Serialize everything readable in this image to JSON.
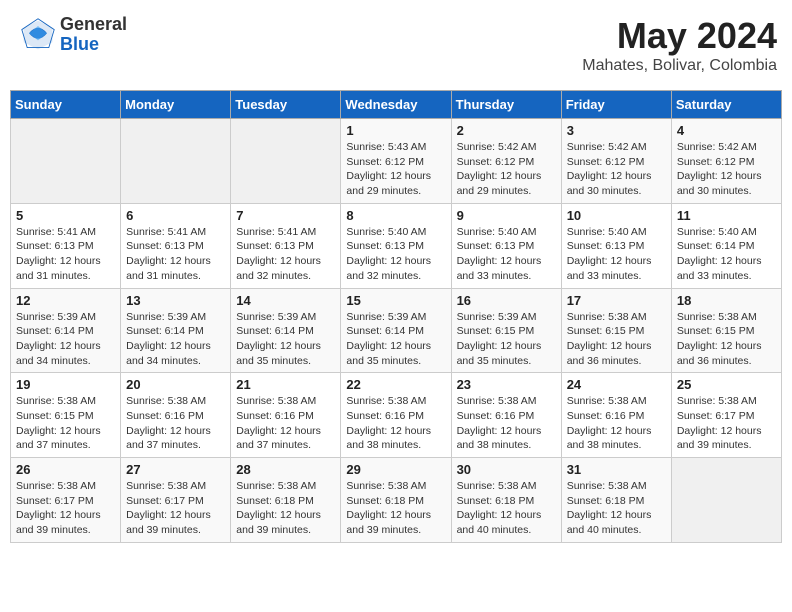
{
  "header": {
    "logo_general": "General",
    "logo_blue": "Blue",
    "month_year": "May 2024",
    "location": "Mahates, Bolivar, Colombia"
  },
  "days_of_week": [
    "Sunday",
    "Monday",
    "Tuesday",
    "Wednesday",
    "Thursday",
    "Friday",
    "Saturday"
  ],
  "weeks": [
    [
      {
        "day": "",
        "info": ""
      },
      {
        "day": "",
        "info": ""
      },
      {
        "day": "",
        "info": ""
      },
      {
        "day": "1",
        "info": "Sunrise: 5:43 AM\nSunset: 6:12 PM\nDaylight: 12 hours and 29 minutes."
      },
      {
        "day": "2",
        "info": "Sunrise: 5:42 AM\nSunset: 6:12 PM\nDaylight: 12 hours and 29 minutes."
      },
      {
        "day": "3",
        "info": "Sunrise: 5:42 AM\nSunset: 6:12 PM\nDaylight: 12 hours and 30 minutes."
      },
      {
        "day": "4",
        "info": "Sunrise: 5:42 AM\nSunset: 6:12 PM\nDaylight: 12 hours and 30 minutes."
      }
    ],
    [
      {
        "day": "5",
        "info": "Sunrise: 5:41 AM\nSunset: 6:13 PM\nDaylight: 12 hours and 31 minutes."
      },
      {
        "day": "6",
        "info": "Sunrise: 5:41 AM\nSunset: 6:13 PM\nDaylight: 12 hours and 31 minutes."
      },
      {
        "day": "7",
        "info": "Sunrise: 5:41 AM\nSunset: 6:13 PM\nDaylight: 12 hours and 32 minutes."
      },
      {
        "day": "8",
        "info": "Sunrise: 5:40 AM\nSunset: 6:13 PM\nDaylight: 12 hours and 32 minutes."
      },
      {
        "day": "9",
        "info": "Sunrise: 5:40 AM\nSunset: 6:13 PM\nDaylight: 12 hours and 33 minutes."
      },
      {
        "day": "10",
        "info": "Sunrise: 5:40 AM\nSunset: 6:13 PM\nDaylight: 12 hours and 33 minutes."
      },
      {
        "day": "11",
        "info": "Sunrise: 5:40 AM\nSunset: 6:14 PM\nDaylight: 12 hours and 33 minutes."
      }
    ],
    [
      {
        "day": "12",
        "info": "Sunrise: 5:39 AM\nSunset: 6:14 PM\nDaylight: 12 hours and 34 minutes."
      },
      {
        "day": "13",
        "info": "Sunrise: 5:39 AM\nSunset: 6:14 PM\nDaylight: 12 hours and 34 minutes."
      },
      {
        "day": "14",
        "info": "Sunrise: 5:39 AM\nSunset: 6:14 PM\nDaylight: 12 hours and 35 minutes."
      },
      {
        "day": "15",
        "info": "Sunrise: 5:39 AM\nSunset: 6:14 PM\nDaylight: 12 hours and 35 minutes."
      },
      {
        "day": "16",
        "info": "Sunrise: 5:39 AM\nSunset: 6:15 PM\nDaylight: 12 hours and 35 minutes."
      },
      {
        "day": "17",
        "info": "Sunrise: 5:38 AM\nSunset: 6:15 PM\nDaylight: 12 hours and 36 minutes."
      },
      {
        "day": "18",
        "info": "Sunrise: 5:38 AM\nSunset: 6:15 PM\nDaylight: 12 hours and 36 minutes."
      }
    ],
    [
      {
        "day": "19",
        "info": "Sunrise: 5:38 AM\nSunset: 6:15 PM\nDaylight: 12 hours and 37 minutes."
      },
      {
        "day": "20",
        "info": "Sunrise: 5:38 AM\nSunset: 6:16 PM\nDaylight: 12 hours and 37 minutes."
      },
      {
        "day": "21",
        "info": "Sunrise: 5:38 AM\nSunset: 6:16 PM\nDaylight: 12 hours and 37 minutes."
      },
      {
        "day": "22",
        "info": "Sunrise: 5:38 AM\nSunset: 6:16 PM\nDaylight: 12 hours and 38 minutes."
      },
      {
        "day": "23",
        "info": "Sunrise: 5:38 AM\nSunset: 6:16 PM\nDaylight: 12 hours and 38 minutes."
      },
      {
        "day": "24",
        "info": "Sunrise: 5:38 AM\nSunset: 6:16 PM\nDaylight: 12 hours and 38 minutes."
      },
      {
        "day": "25",
        "info": "Sunrise: 5:38 AM\nSunset: 6:17 PM\nDaylight: 12 hours and 39 minutes."
      }
    ],
    [
      {
        "day": "26",
        "info": "Sunrise: 5:38 AM\nSunset: 6:17 PM\nDaylight: 12 hours and 39 minutes."
      },
      {
        "day": "27",
        "info": "Sunrise: 5:38 AM\nSunset: 6:17 PM\nDaylight: 12 hours and 39 minutes."
      },
      {
        "day": "28",
        "info": "Sunrise: 5:38 AM\nSunset: 6:18 PM\nDaylight: 12 hours and 39 minutes."
      },
      {
        "day": "29",
        "info": "Sunrise: 5:38 AM\nSunset: 6:18 PM\nDaylight: 12 hours and 39 minutes."
      },
      {
        "day": "30",
        "info": "Sunrise: 5:38 AM\nSunset: 6:18 PM\nDaylight: 12 hours and 40 minutes."
      },
      {
        "day": "31",
        "info": "Sunrise: 5:38 AM\nSunset: 6:18 PM\nDaylight: 12 hours and 40 minutes."
      },
      {
        "day": "",
        "info": ""
      }
    ]
  ]
}
